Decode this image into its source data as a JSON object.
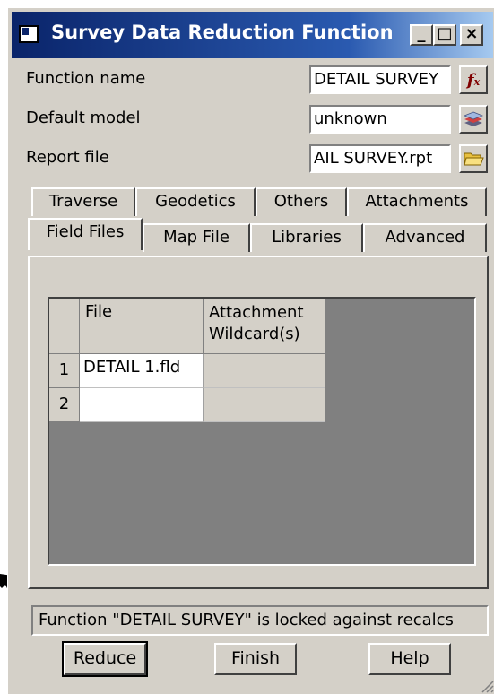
{
  "window": {
    "title": "Survey Data Reduction Function",
    "controls": [
      "_",
      "□",
      "×"
    ]
  },
  "form": {
    "function_name_label": "Function name",
    "function_name_value": "DETAIL SURVEY",
    "default_model_label": "Default model",
    "default_model_value": "unknown",
    "report_file_label": "Report file",
    "report_file_value": "AIL SURVEY.rpt"
  },
  "tabs": {
    "back_row": [
      "Traverse",
      "Geodetics",
      "Others",
      "Attachments"
    ],
    "front_row": [
      "Field Files",
      "Map File",
      "Libraries",
      "Advanced"
    ],
    "active": "Field Files"
  },
  "grid": {
    "columns": [
      "File",
      "Attachment Wildcard(s)"
    ],
    "rows": [
      {
        "num": "1",
        "file": "DETAIL 1.fld",
        "wildcard": ""
      },
      {
        "num": "2",
        "file": "",
        "wildcard": ""
      }
    ]
  },
  "status": "Function \"DETAIL SURVEY\" is locked against recalcs",
  "buttons": {
    "reduce": "Reduce",
    "finish": "Finish",
    "help": "Help"
  },
  "icons": {
    "function": "fx-icon",
    "model": "layers-icon",
    "report": "folder-icon"
  }
}
